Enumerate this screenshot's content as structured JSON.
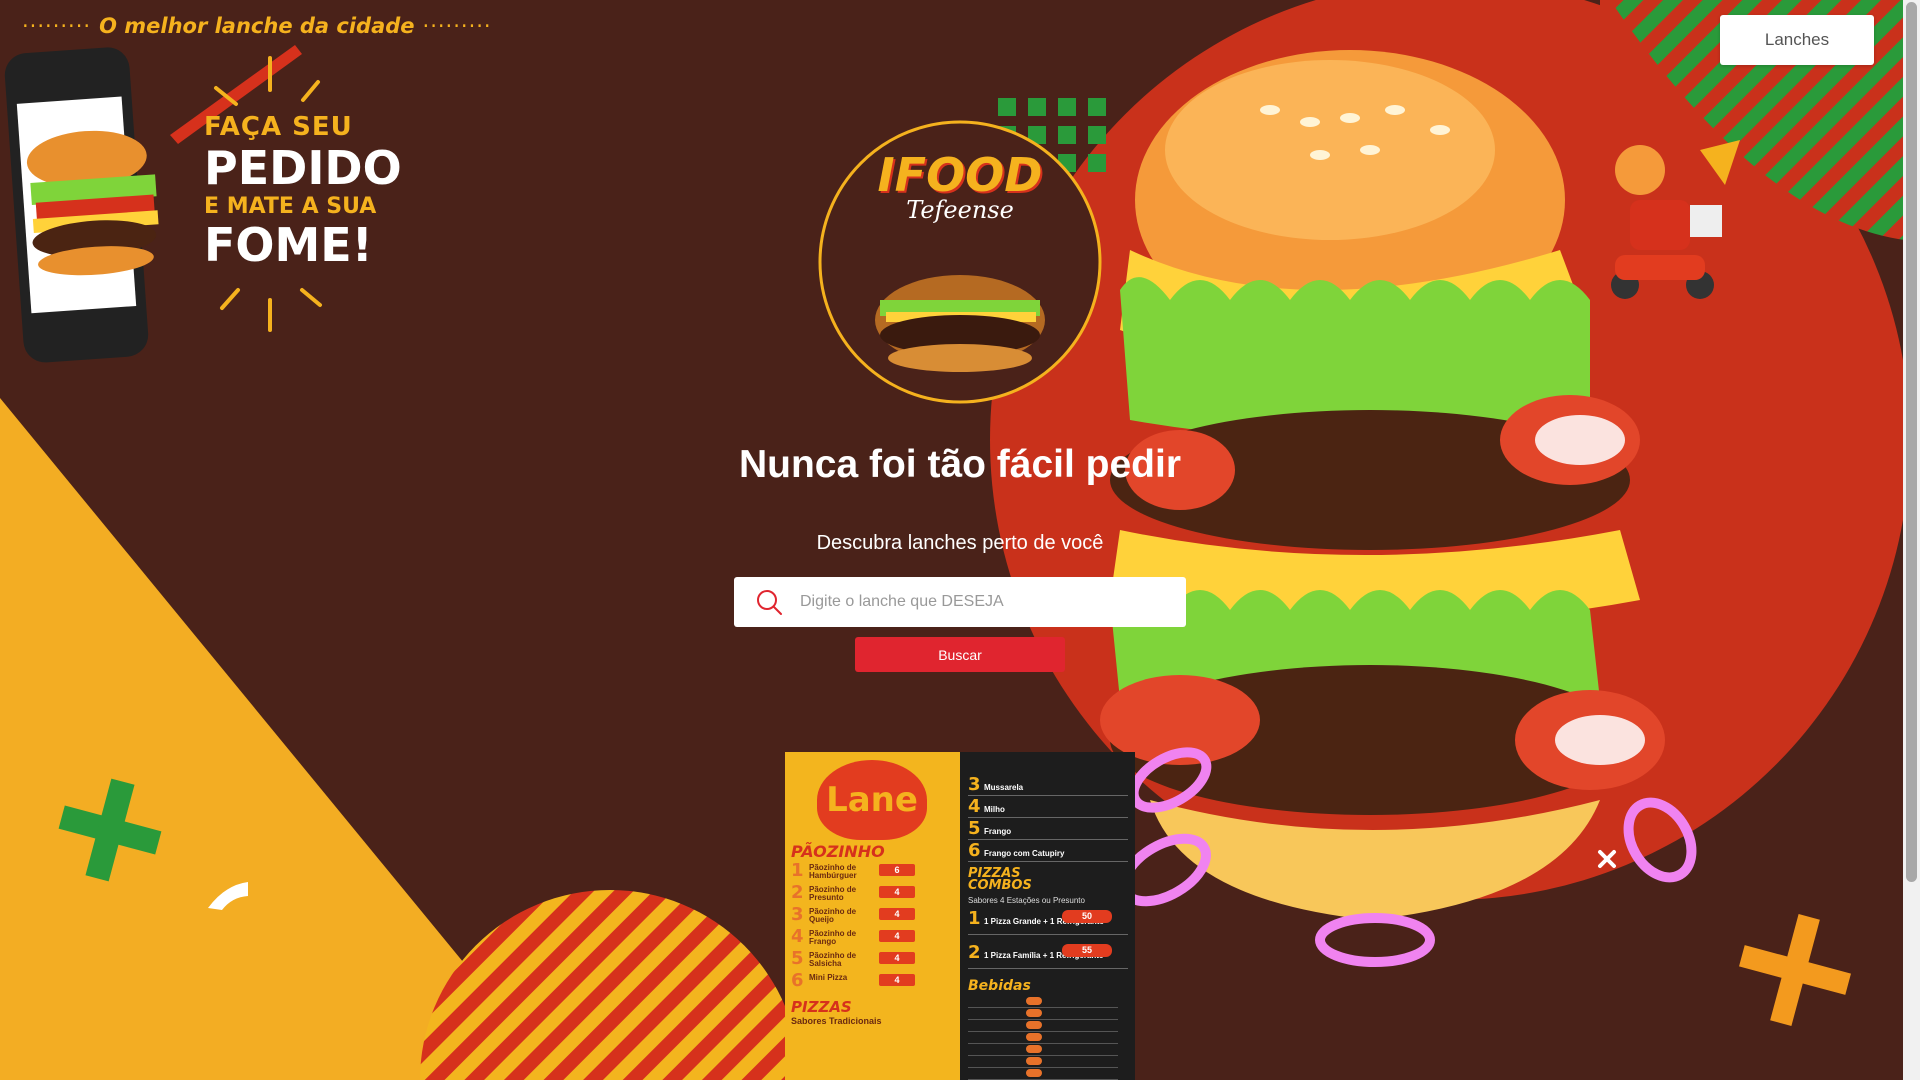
{
  "header": {
    "tagline": "O melhor lanche da cidade",
    "tagline_dots": "·········",
    "nav_button": "Lanches"
  },
  "promo": {
    "line1": "FAÇA SEU",
    "line2": "PEDIDO",
    "line3": "E MATE A SUA",
    "line4": "FOME!"
  },
  "logo": {
    "brand": "IFOOD",
    "script": "Tefeense"
  },
  "hero": {
    "title": "Nunca foi tão fácil pedir",
    "subtitle": "Descubra lanches perto de você"
  },
  "search": {
    "placeholder": "Digite o lanche que DESEJA",
    "value": "",
    "button": "Buscar"
  },
  "menu_card": {
    "brand": "Lane",
    "section_paozinho": "PÃOZINHO",
    "left_items": [
      {
        "n": "1",
        "name": "Pãozinho de Hambúrguer",
        "price": "6"
      },
      {
        "n": "2",
        "name": "Pãozinho de Presunto",
        "price": "4"
      },
      {
        "n": "3",
        "name": "Pãozinho de Queijo",
        "price": "4"
      },
      {
        "n": "4",
        "name": "Pãozinho de Frango",
        "price": "4"
      },
      {
        "n": "5",
        "name": "Pãozinho de Salsicha",
        "price": "4"
      },
      {
        "n": "6",
        "name": "Mini Pizza",
        "price": "4"
      }
    ],
    "section_pizzas": "PIZZAS",
    "pizzas_sub": "Sabores Tradicionais",
    "right_items": [
      {
        "n": "3",
        "name": "Mussarela"
      },
      {
        "n": "4",
        "name": "Milho"
      },
      {
        "n": "5",
        "name": "Frango"
      },
      {
        "n": "6",
        "name": "Frango com Catupiry"
      }
    ],
    "section_combos": "PIZZAS COMBOS",
    "combos_sub": "Sabores 4 Estações ou Presunto",
    "combos": [
      {
        "n": "1",
        "name": "1 Pizza Grande + 1 Refrigerante",
        "price": "50"
      },
      {
        "n": "2",
        "name": "1 Pizza Família + 1 Refrigerante",
        "price": "55"
      }
    ],
    "section_bebidas": "Bebidas"
  },
  "colors": {
    "background": "#4a2219",
    "accent_yellow": "#f5b21e",
    "accent_red": "#e0252f",
    "green": "#2a9a3a"
  }
}
